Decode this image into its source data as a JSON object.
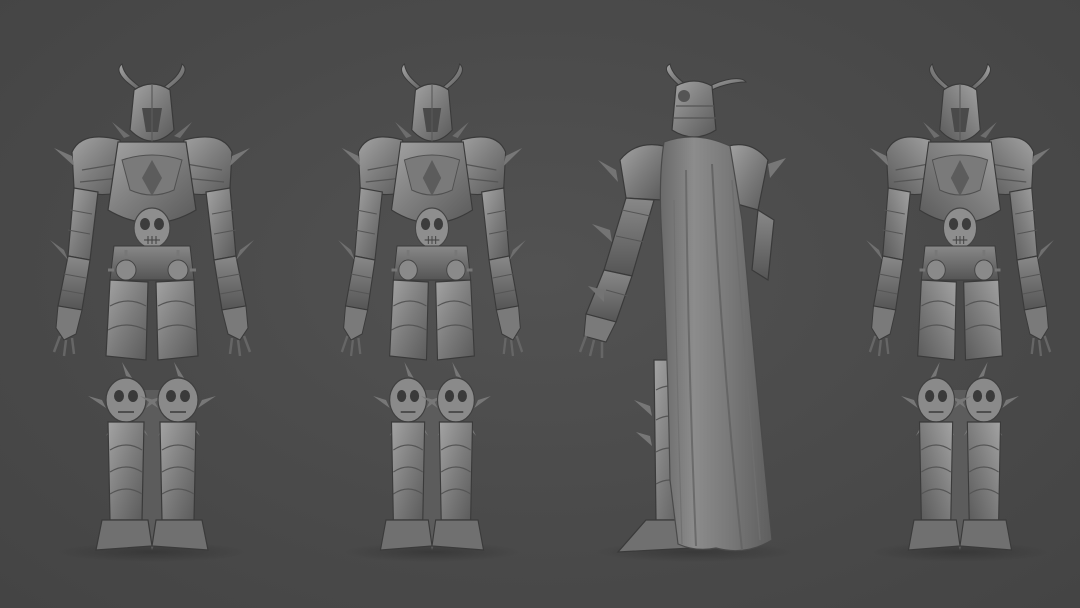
{
  "scene": {
    "background": "#4b4b4b",
    "material_color": "#8a8a8a",
    "shadow_color": "#3c3c3c",
    "highlight_color": "#a8a8a8"
  },
  "views": [
    {
      "id": "front",
      "pose": "front",
      "has_cape_visible_front": false
    },
    {
      "id": "three-quarter-front",
      "pose": "three-quarter-front",
      "has_cape_visible_front": false
    },
    {
      "id": "back",
      "pose": "back-three-quarter",
      "has_cape_visible_front": true
    },
    {
      "id": "three-quarter-side",
      "pose": "three-quarter-side",
      "has_cape_visible_front": false
    }
  ]
}
